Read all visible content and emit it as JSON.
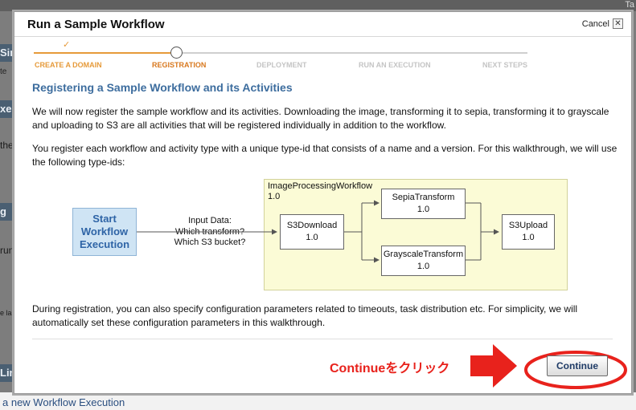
{
  "background": {
    "topbar_right": "Ta",
    "side_fragments": [
      "Sin",
      "te",
      "xe",
      "the",
      "g S",
      "run",
      "e la",
      "Lin"
    ],
    "bottom_link": "a new Workflow Execution"
  },
  "dialog": {
    "title": "Run a Sample Workflow",
    "cancel_label": "Cancel",
    "close_glyph": "✕",
    "steps": [
      {
        "label": "CREATE A DOMAIN",
        "status": "done"
      },
      {
        "label": "REGISTRATION",
        "status": "current"
      },
      {
        "label": "DEPLOYMENT",
        "status": "todo"
      },
      {
        "label": "RUN AN EXECUTION",
        "status": "todo"
      },
      {
        "label": "NEXT STEPS",
        "status": "todo"
      }
    ],
    "check_glyph": "✓",
    "heading": "Registering a Sample Workflow and its Activities",
    "para1": "We will now register the sample workflow and its activities. Downloading the image, transforming it to sepia, transforming it to grayscale and uploading to S3 are all activities that will be registered individually in addition to the workflow.",
    "para2": "You register each workflow and activity type with a unique type-id that consists of a name and a version. For this walkthrough, we will use the following type-ids:",
    "diagram": {
      "start_label": [
        "Start",
        "Workflow",
        "Execution"
      ],
      "input_label": [
        "Input Data:",
        "Which transform?",
        "Which S3 bucket?"
      ],
      "workflow_name": "ImageProcessingWorkflow",
      "workflow_version": "1.0",
      "nodes": {
        "s3download": {
          "name": "S3Download",
          "version": "1.0"
        },
        "sepia": {
          "name": "SepiaTransform",
          "version": "1.0"
        },
        "grayscale": {
          "name": "GrayscaleTransform",
          "version": "1.0"
        },
        "s3upload": {
          "name": "S3Upload",
          "version": "1.0"
        }
      }
    },
    "para3": "During registration, you can also specify configuration parameters related to timeouts, task distribution etc. For simplicity, we will automatically set these configuration parameters in this walkthrough.",
    "annotation": "Continueをクリック",
    "continue_label": "Continue"
  },
  "colors": {
    "done_step": "#e69a3a",
    "current_step": "#e08a2a",
    "todo_step": "#c8c8c8",
    "heading": "#3d6d9e",
    "annotation": "#e8221c"
  }
}
